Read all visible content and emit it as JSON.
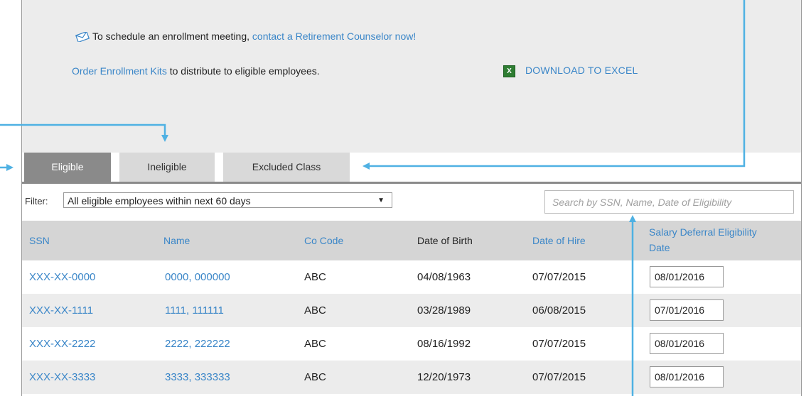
{
  "info": {
    "schedule_text": "To schedule an enrollment meeting,",
    "schedule_link": "contact a Retirement Counselor now!",
    "order_link": "Order Enrollment Kits",
    "order_text": "to distribute to eligible employees.",
    "excel_link": "DOWNLOAD TO EXCEL",
    "excel_icon_glyph": "X"
  },
  "tabs": [
    {
      "label": "Eligible",
      "active": true
    },
    {
      "label": "Ineligible",
      "active": false
    },
    {
      "label": "Excluded Class",
      "active": false
    }
  ],
  "filter": {
    "label": "Filter:",
    "selected": "All eligible employees within next 60 days",
    "caret": "▼"
  },
  "search": {
    "placeholder": "Search by SSN, Name, Date of Eligibility"
  },
  "table": {
    "headers": {
      "ssn": "SSN",
      "name": "Name",
      "co_code": "Co Code",
      "dob": "Date of Birth",
      "doh": "Date of Hire",
      "sde_line1": "Salary Deferral Eligibility",
      "sde_line2": "Date"
    },
    "rows": [
      {
        "ssn": "XXX-XX-0000",
        "name": "0000, 000000",
        "co_code": "ABC",
        "dob": "04/08/1963",
        "doh": "07/07/2015",
        "sde": "08/01/2016"
      },
      {
        "ssn": "XXX-XX-1111",
        "name": "1111, 111111",
        "co_code": "ABC",
        "dob": "03/28/1989",
        "doh": "06/08/2015",
        "sde": "07/01/2016"
      },
      {
        "ssn": "XXX-XX-2222",
        "name": "2222, 222222",
        "co_code": "ABC",
        "dob": "08/16/1992",
        "doh": "07/07/2015",
        "sde": "08/01/2016"
      },
      {
        "ssn": "XXX-XX-3333",
        "name": "3333, 333333",
        "co_code": "ABC",
        "dob": "12/20/1973",
        "doh": "07/07/2015",
        "sde": "08/01/2016"
      }
    ]
  },
  "colors": {
    "link": "#3a86c8",
    "callout": "#4fb1e3",
    "tab_active": "#8a8a8a",
    "tab_inactive": "#d9d9d9"
  }
}
